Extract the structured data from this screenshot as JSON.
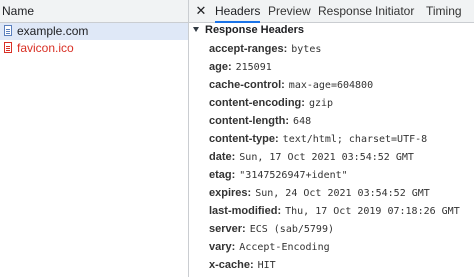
{
  "request_list": {
    "column_header": "Name",
    "items": [
      {
        "label": "example.com",
        "selected": true,
        "error": false
      },
      {
        "label": "favicon.ico",
        "selected": false,
        "error": true
      }
    ]
  },
  "details": {
    "close_glyph": "✕",
    "tabs": [
      {
        "label": "Headers",
        "active": true
      },
      {
        "label": "Preview",
        "active": false
      },
      {
        "label": "Response",
        "active": false
      },
      {
        "label": "Initiator",
        "active": false
      },
      {
        "label": "Timing",
        "active": false
      }
    ],
    "section_title": "Response Headers",
    "headers": [
      {
        "name": "accept-ranges:",
        "value": "bytes"
      },
      {
        "name": "age:",
        "value": "215091"
      },
      {
        "name": "cache-control:",
        "value": "max-age=604800"
      },
      {
        "name": "content-encoding:",
        "value": "gzip"
      },
      {
        "name": "content-length:",
        "value": "648"
      },
      {
        "name": "content-type:",
        "value": "text/html; charset=UTF-8"
      },
      {
        "name": "date:",
        "value": "Sun, 17 Oct 2021 03:54:52 GMT"
      },
      {
        "name": "etag:",
        "value": "\"3147526947+ident\""
      },
      {
        "name": "expires:",
        "value": "Sun, 24 Oct 2021 03:54:52 GMT"
      },
      {
        "name": "last-modified:",
        "value": "Thu, 17 Oct 2019 07:18:26 GMT"
      },
      {
        "name": "server:",
        "value": "ECS (sab/5799)"
      },
      {
        "name": "vary:",
        "value": "Accept-Encoding"
      },
      {
        "name": "x-cache:",
        "value": "HIT"
      }
    ]
  },
  "colors": {
    "active_tab_underline": "#1a73e8",
    "selected_row": "#dfe8f7",
    "error_text": "#d93025"
  }
}
